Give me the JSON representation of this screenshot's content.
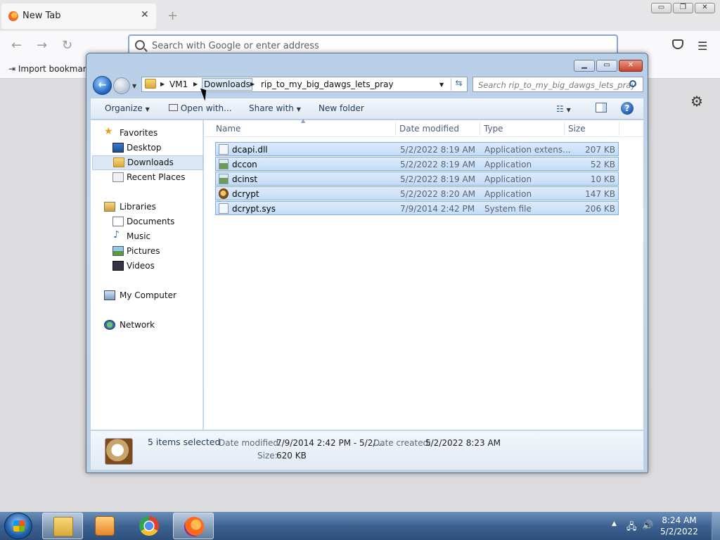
{
  "browser": {
    "tab_title": "New Tab",
    "tab_close": "✕",
    "new_tab": "+",
    "window_buttons": [
      "▭",
      "❐",
      "✕"
    ],
    "url_placeholder": "Search with Google or enter address",
    "bookmark_import": "Import bookmark"
  },
  "explorer": {
    "address": {
      "crumbs": [
        "VM1",
        "Downloads",
        "rip_to_my_big_dawgs_lets_pray"
      ]
    },
    "search_placeholder": "Search rip_to_my_big_dawgs_lets_pray",
    "toolbar": {
      "organize": "Organize",
      "open_with": "Open with...",
      "share_with": "Share with",
      "new_folder": "New folder",
      "help": "?"
    },
    "nav": {
      "favorites": "Favorites",
      "desktop": "Desktop",
      "downloads": "Downloads",
      "recent_places": "Recent Places",
      "libraries": "Libraries",
      "documents": "Documents",
      "music": "Music",
      "pictures": "Pictures",
      "videos": "Videos",
      "my_computer": "My Computer",
      "network": "Network"
    },
    "columns": {
      "name": "Name",
      "date_modified": "Date modified",
      "type": "Type",
      "size": "Size"
    },
    "files": [
      {
        "name": "dcapi.dll",
        "date": "5/2/2022 8:19 AM",
        "type": "Application extens...",
        "size": "207 KB"
      },
      {
        "name": "dccon",
        "date": "5/2/2022 8:19 AM",
        "type": "Application",
        "size": "52 KB"
      },
      {
        "name": "dcinst",
        "date": "5/2/2022 8:19 AM",
        "type": "Application",
        "size": "10 KB"
      },
      {
        "name": "dcrypt",
        "date": "5/2/2022 8:20 AM",
        "type": "Application",
        "size": "147 KB"
      },
      {
        "name": "dcrypt.sys",
        "date": "7/9/2014 2:42 PM",
        "type": "System file",
        "size": "206 KB"
      }
    ],
    "details": {
      "count": "5 items selected",
      "date_modified_label": "Date modified:",
      "date_modified_value": "7/9/2014 2:42 PM - 5/2/...",
      "date_created_label": "Date created:",
      "date_created_value": "5/2/2022 8:23 AM",
      "size_label": "Size:",
      "size_value": "620 KB"
    }
  },
  "taskbar": {
    "time": "8:24 AM",
    "date": "5/2/2022"
  }
}
